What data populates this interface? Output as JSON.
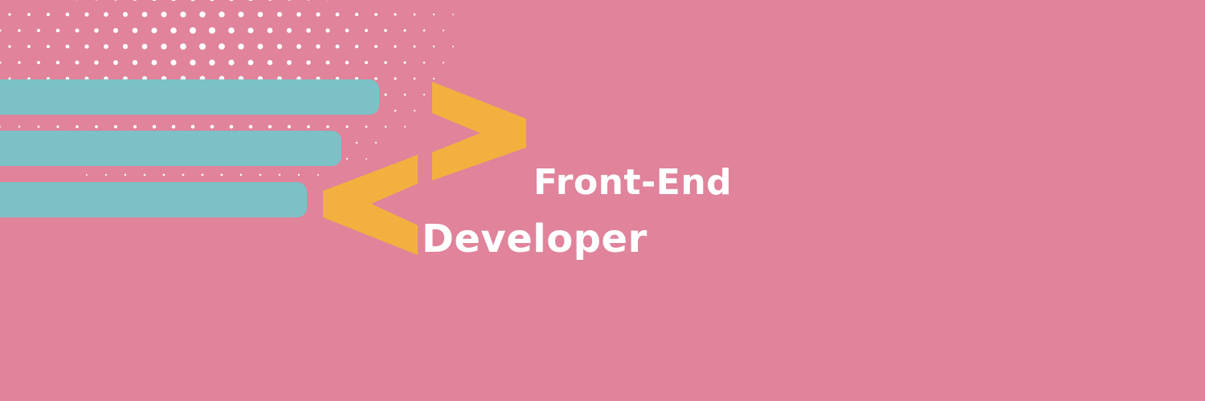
{
  "banner": {
    "line1": "Front-End",
    "line2": "Developer"
  },
  "colors": {
    "background": "#e0839b",
    "bars": "#7cc1c6",
    "chevrons": "#f2b13f",
    "text": "#ffffff"
  }
}
